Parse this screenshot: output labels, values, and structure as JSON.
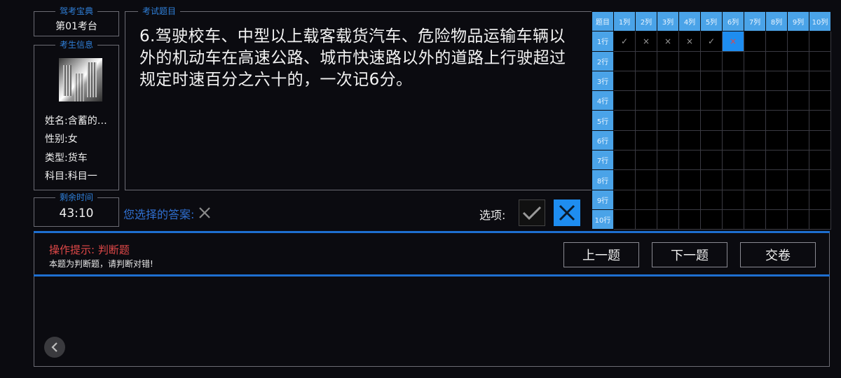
{
  "app": {
    "legend": "驾考宝典",
    "value": "第01考台"
  },
  "candidate": {
    "legend": "考生信息",
    "name": "姓名:含蓄的…",
    "gender": "性别:女",
    "type": "类型:货车",
    "subject": "科目一"
  },
  "question": {
    "legend": "考试题目",
    "text": "6.驾驶校车、中型以上载客载货汽车、危险物品运输车辆以外的机动车在高速公路、城市快速路以外的道路上行驶超过规定时速百分之六十的，一次记6分。"
  },
  "timer": {
    "legend": "剩余时间",
    "value": "43:10"
  },
  "answer": {
    "label": "您选择的答案:",
    "selected_icon": "cross-icon"
  },
  "options": {
    "label": "选项:",
    "true_icon": "check-icon",
    "false_icon": "cross-icon",
    "selected": "false"
  },
  "grid": {
    "corner": "题目",
    "cols": [
      "1列",
      "2列",
      "3列",
      "4列",
      "5列",
      "6列",
      "7列",
      "8列",
      "9列",
      "10列"
    ],
    "rows": [
      "1行",
      "2行",
      "3行",
      "4行",
      "5行",
      "6行",
      "7行",
      "8行",
      "9行",
      "10行"
    ],
    "row1_marks": [
      "✓",
      "×",
      "×",
      "×",
      "✓",
      "×",
      "",
      "",
      "",
      ""
    ],
    "current_cell": "6列"
  },
  "hint": {
    "title": "操作提示: 判断题",
    "body": "本题为判断题，请判断对错!"
  },
  "nav": {
    "prev": "上一题",
    "next": "下一题",
    "submit": "交卷"
  },
  "colors": {
    "accent": "#1e8df0",
    "grid_header": "#4aa3e8",
    "hint_red": "#e04848",
    "label_blue": "#2f6fd0"
  }
}
